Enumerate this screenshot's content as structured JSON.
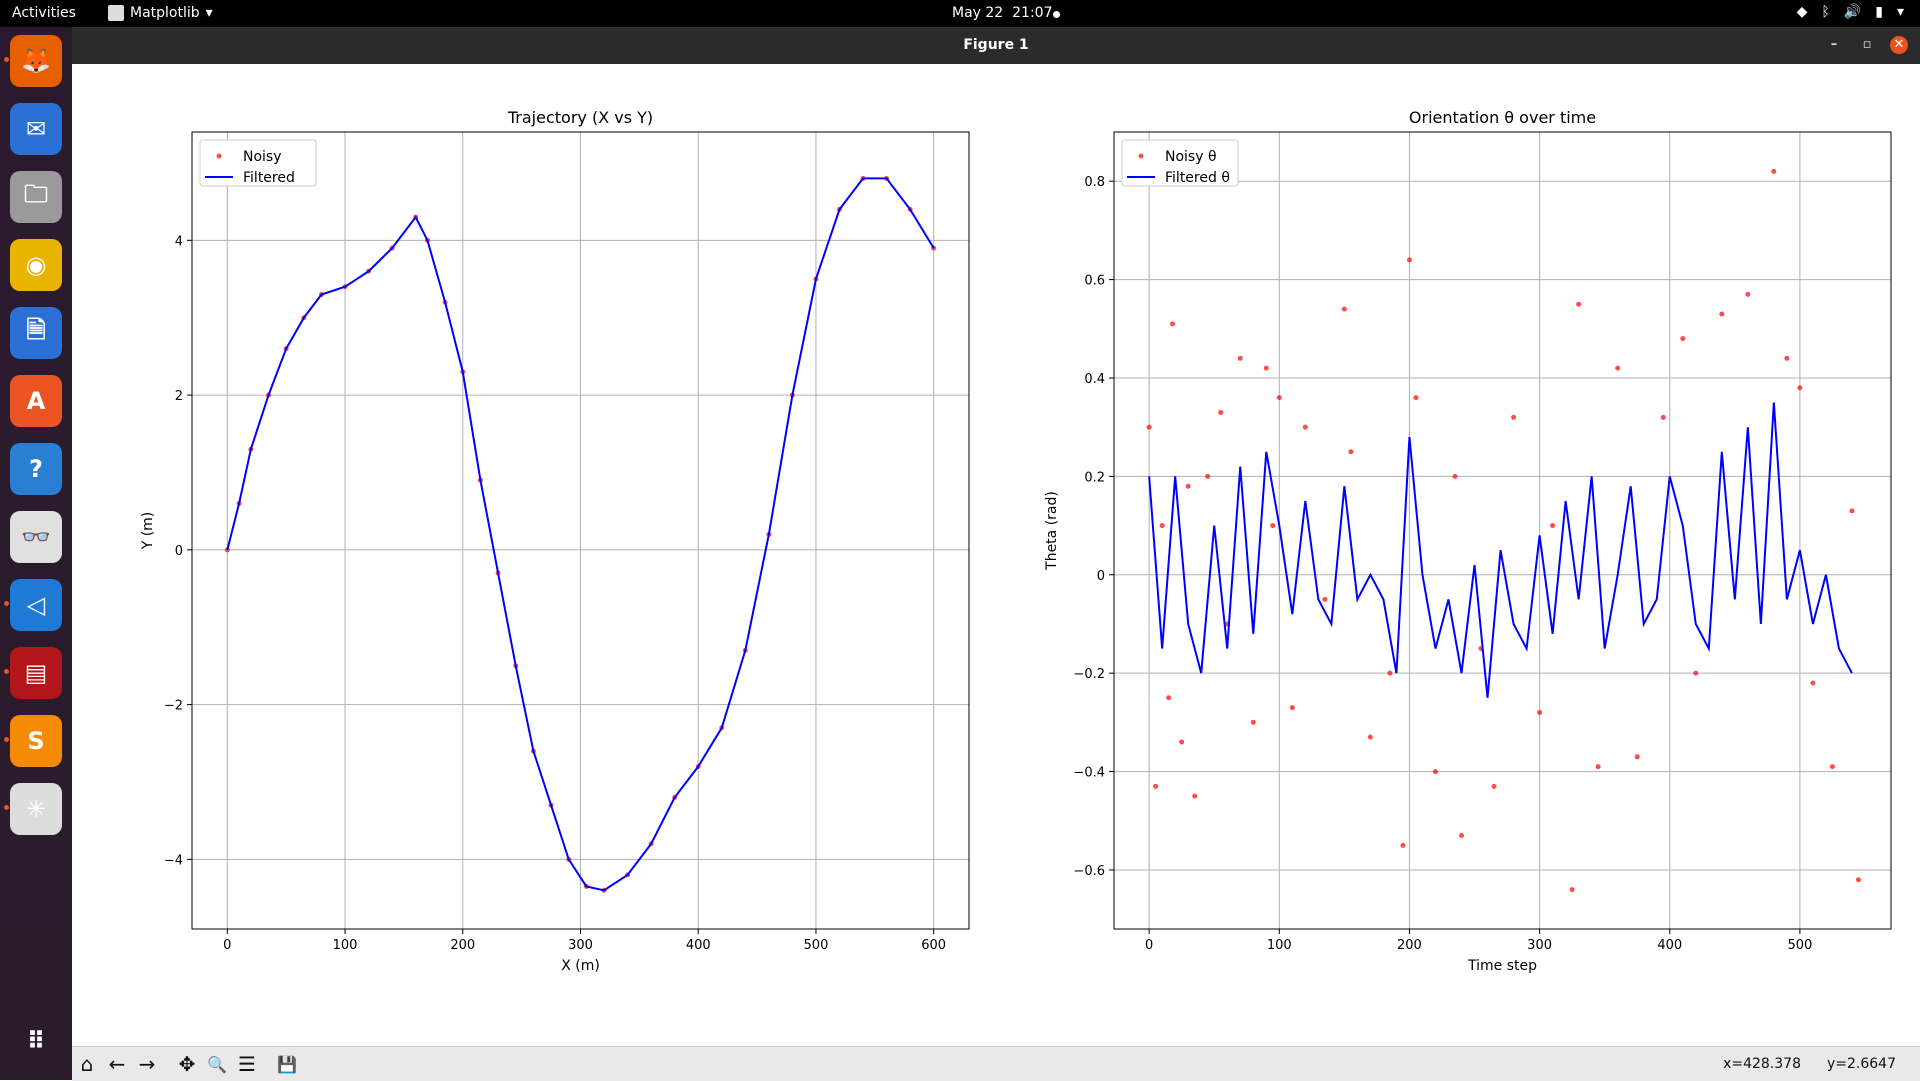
{
  "topbar": {
    "activities": "Activities",
    "app_name": "Matplotlib",
    "date": "May 22",
    "time": "21:07"
  },
  "window": {
    "title": "Figure 1",
    "minimize": "–",
    "maximize": "▫",
    "close": "✕"
  },
  "dock": [
    {
      "name": "firefox",
      "glyph": "🦊",
      "color": "#e66000",
      "running": true
    },
    {
      "name": "thunderbird",
      "glyph": "✉",
      "color": "#2a6fd3",
      "running": false
    },
    {
      "name": "files",
      "glyph": "🗀",
      "color": "#9a9a9a",
      "running": false
    },
    {
      "name": "rhythmbox",
      "glyph": "◉",
      "color": "#e8b400",
      "running": false
    },
    {
      "name": "writer",
      "glyph": "🗎",
      "color": "#2a6fd3",
      "running": false
    },
    {
      "name": "software",
      "glyph": "A",
      "color": "#e95420",
      "running": false
    },
    {
      "name": "help",
      "glyph": "?",
      "color": "#2a7fd3",
      "running": false
    },
    {
      "name": "document-viewer",
      "glyph": "👓",
      "color": "#e0e0e0",
      "running": false
    },
    {
      "name": "vscode",
      "glyph": "◁",
      "color": "#1f7ad6",
      "running": true
    },
    {
      "name": "terminal",
      "glyph": "▤",
      "color": "#b3161a",
      "running": true
    },
    {
      "name": "sublime",
      "glyph": "S",
      "color": "#f58a07",
      "running": true
    },
    {
      "name": "matplotlib",
      "glyph": "✳",
      "color": "#dddddd",
      "running": true
    },
    {
      "name": "show-apps",
      "glyph": "⠿",
      "color": "transparent",
      "running": false
    }
  ],
  "toolbar": {
    "home": "⌂",
    "back": "←",
    "forward": "→",
    "pan": "✥",
    "zoom": "🔍",
    "configure": "☰",
    "save": "💾",
    "x_readout": "x=428.378",
    "y_readout": "y=2.6647"
  },
  "chart_data": [
    {
      "type": "line",
      "title": "Trajectory (X vs Y)",
      "xlabel": "X (m)",
      "ylabel": "Y (m)",
      "xlim": [
        -30,
        630
      ],
      "ylim": [
        -4.9,
        5.4
      ],
      "xticks": [
        0,
        100,
        200,
        300,
        400,
        500,
        600
      ],
      "yticks": [
        -4,
        -2,
        0,
        2,
        4
      ],
      "grid": true,
      "legend_location": "top-left",
      "series": [
        {
          "name": "Noisy",
          "style": "scatter",
          "color": "#ff0000",
          "x": [
            0,
            10,
            20,
            35,
            50,
            65,
            80,
            100,
            120,
            140,
            160,
            170,
            185,
            200,
            215,
            230,
            245,
            260,
            275,
            290,
            305,
            320,
            340,
            360,
            380,
            400,
            420,
            440,
            460,
            480,
            500,
            520,
            540,
            560,
            580,
            600
          ],
          "y": [
            0,
            0.6,
            1.3,
            2.0,
            2.6,
            3.0,
            3.3,
            3.4,
            3.6,
            3.9,
            4.3,
            4.0,
            3.2,
            2.3,
            0.9,
            -0.3,
            -1.5,
            -2.6,
            -3.3,
            -4.0,
            -4.35,
            -4.4,
            -4.2,
            -3.8,
            -3.2,
            -2.8,
            -2.3,
            -1.3,
            0.2,
            2.0,
            3.5,
            4.4,
            4.8,
            4.8,
            4.4,
            3.9
          ]
        },
        {
          "name": "Filtered",
          "style": "line",
          "color": "#0000ff",
          "x": [
            0,
            10,
            20,
            35,
            50,
            65,
            80,
            100,
            120,
            140,
            160,
            170,
            185,
            200,
            215,
            230,
            245,
            260,
            275,
            290,
            305,
            320,
            340,
            360,
            380,
            400,
            420,
            440,
            460,
            480,
            500,
            520,
            540,
            560,
            580,
            600
          ],
          "y": [
            0,
            0.6,
            1.3,
            2.0,
            2.6,
            3.0,
            3.3,
            3.4,
            3.6,
            3.9,
            4.3,
            4.0,
            3.2,
            2.3,
            0.9,
            -0.3,
            -1.5,
            -2.6,
            -3.3,
            -4.0,
            -4.35,
            -4.4,
            -4.2,
            -3.8,
            -3.2,
            -2.8,
            -2.3,
            -1.3,
            0.2,
            2.0,
            3.5,
            4.4,
            4.8,
            4.8,
            4.4,
            3.9
          ]
        }
      ]
    },
    {
      "type": "line",
      "title": "Orientation θ over time",
      "xlabel": "Time step",
      "ylabel": "Theta (rad)",
      "xlim": [
        -27,
        570
      ],
      "ylim": [
        -0.72,
        0.9
      ],
      "xticks": [
        0,
        100,
        200,
        300,
        400,
        500
      ],
      "yticks": [
        -0.6,
        -0.4,
        -0.2,
        0.0,
        0.2,
        0.4,
        0.6,
        0.8
      ],
      "grid": true,
      "legend_location": "top-left",
      "series": [
        {
          "name": "Noisy θ",
          "style": "scatter",
          "color": "#ff0000",
          "x": [
            0,
            5,
            10,
            15,
            18,
            25,
            30,
            35,
            45,
            55,
            60,
            70,
            80,
            90,
            95,
            100,
            110,
            120,
            135,
            150,
            155,
            170,
            185,
            195,
            200,
            205,
            220,
            235,
            240,
            255,
            265,
            280,
            300,
            310,
            325,
            330,
            345,
            360,
            375,
            395,
            410,
            420,
            440,
            460,
            480,
            490,
            500,
            510,
            525,
            540,
            545
          ],
          "y": [
            0.3,
            -0.43,
            0.1,
            -0.25,
            0.51,
            -0.34,
            0.18,
            -0.45,
            0.2,
            0.33,
            -0.1,
            0.44,
            -0.3,
            0.42,
            0.1,
            0.36,
            -0.27,
            0.3,
            -0.05,
            0.54,
            0.25,
            -0.33,
            -0.2,
            -0.55,
            0.64,
            0.36,
            -0.4,
            0.2,
            -0.53,
            -0.15,
            -0.43,
            0.32,
            -0.28,
            0.1,
            -0.64,
            0.55,
            -0.39,
            0.42,
            -0.37,
            0.32,
            0.48,
            -0.2,
            0.53,
            0.57,
            0.82,
            0.44,
            0.38,
            -0.22,
            -0.39,
            0.13,
            -0.62
          ]
        },
        {
          "name": "Filtered θ",
          "style": "line",
          "color": "#0000ff",
          "x": [
            0,
            10,
            20,
            30,
            40,
            50,
            60,
            70,
            80,
            90,
            100,
            110,
            120,
            130,
            140,
            150,
            160,
            170,
            180,
            190,
            200,
            210,
            220,
            230,
            240,
            250,
            260,
            270,
            280,
            290,
            300,
            310,
            320,
            330,
            340,
            350,
            360,
            370,
            380,
            390,
            400,
            410,
            420,
            430,
            440,
            450,
            460,
            470,
            480,
            490,
            500,
            510,
            520,
            530,
            540
          ],
          "y": [
            0.2,
            -0.15,
            0.2,
            -0.1,
            -0.2,
            0.1,
            -0.15,
            0.22,
            -0.12,
            0.25,
            0.1,
            -0.08,
            0.15,
            -0.05,
            -0.1,
            0.18,
            -0.05,
            0.0,
            -0.05,
            -0.2,
            0.28,
            0.0,
            -0.15,
            -0.05,
            -0.2,
            0.02,
            -0.25,
            0.05,
            -0.1,
            -0.15,
            0.08,
            -0.12,
            0.15,
            -0.05,
            0.2,
            -0.15,
            0.0,
            0.18,
            -0.1,
            -0.05,
            0.2,
            0.1,
            -0.1,
            -0.15,
            0.25,
            -0.05,
            0.3,
            -0.1,
            0.35,
            -0.05,
            0.05,
            -0.1,
            0.0,
            -0.15,
            -0.2
          ]
        }
      ]
    }
  ]
}
